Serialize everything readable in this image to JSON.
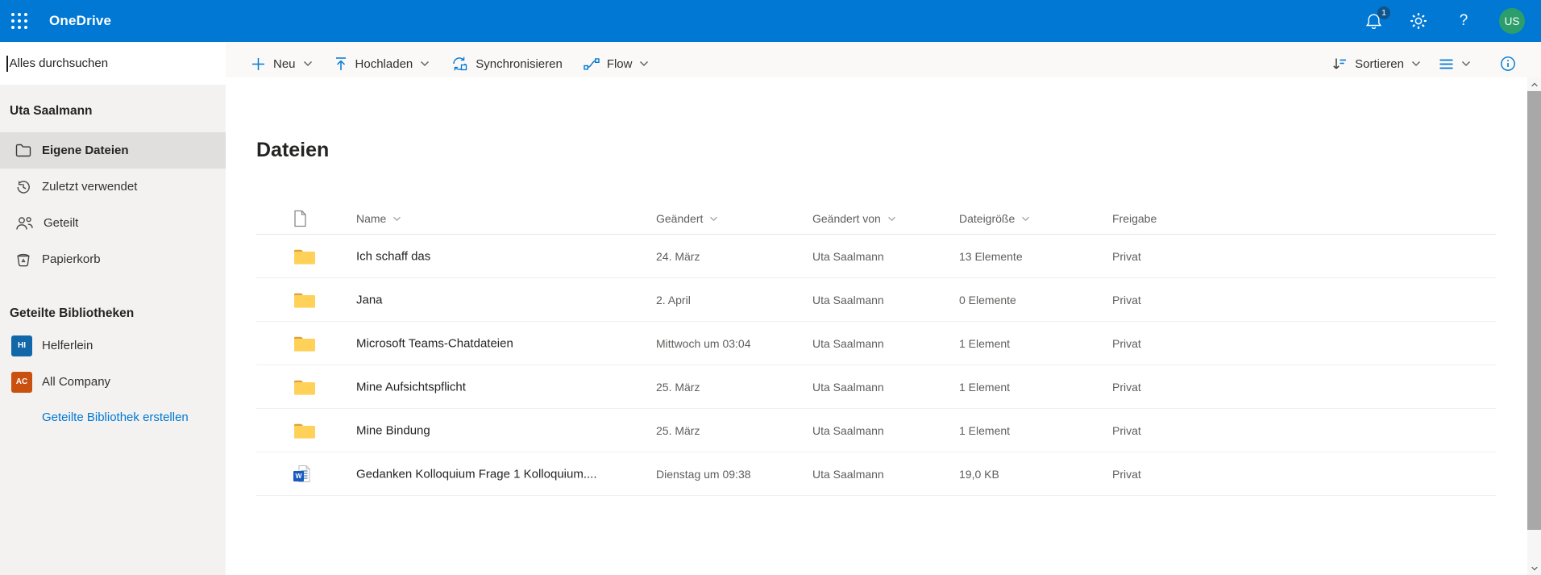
{
  "appbar": {
    "brand": "OneDrive",
    "notification_count": "1",
    "help_label": "?",
    "avatar_initials": "US",
    "colors": {
      "bar": "#0078D4",
      "badge": "#0F548C",
      "avatar": "#2B9E6B"
    }
  },
  "search": {
    "placeholder": "Alles durchsuchen"
  },
  "sidebar": {
    "owner": "Uta Saalmann",
    "items": [
      {
        "label": "Eigene Dateien",
        "icon": "folder-icon",
        "selected": true
      },
      {
        "label": "Zuletzt verwendet",
        "icon": "history-icon",
        "selected": false
      },
      {
        "label": "Geteilt",
        "icon": "people-icon",
        "selected": false
      },
      {
        "label": "Papierkorb",
        "icon": "recycle-bin-icon",
        "selected": false
      }
    ],
    "libraries_header": "Geteilte Bibliotheken",
    "libraries": [
      {
        "initials": "HI",
        "label": "Helferlein",
        "color": "#1267A9"
      },
      {
        "initials": "AC",
        "label": "All Company",
        "color": "#CA5010"
      }
    ],
    "create_library_link": "Geteilte Bibliothek erstellen"
  },
  "toolbar": {
    "new_label": "Neu",
    "upload_label": "Hochladen",
    "sync_label": "Synchronisieren",
    "flow_label": "Flow",
    "sort_label": "Sortieren"
  },
  "main": {
    "title": "Dateien",
    "table": {
      "columns": {
        "name": "Name",
        "modified": "Geändert",
        "modified_by": "Geändert von",
        "size": "Dateigröße",
        "sharing": "Freigabe"
      },
      "rows": [
        {
          "type": "folder",
          "name": "Ich schaff das",
          "modified": "24. März",
          "modified_by": "Uta Saalmann",
          "size": "13 Elemente",
          "sharing": "Privat"
        },
        {
          "type": "folder",
          "name": "Jana",
          "modified": "2. April",
          "modified_by": "Uta Saalmann",
          "size": "0 Elemente",
          "sharing": "Privat"
        },
        {
          "type": "folder",
          "name": "Microsoft Teams-Chatdateien",
          "modified": "Mittwoch um 03:04",
          "modified_by": "Uta Saalmann",
          "size": "1 Element",
          "sharing": "Privat"
        },
        {
          "type": "folder",
          "name": "Mine Aufsichtspflicht",
          "modified": "25. März",
          "modified_by": "Uta Saalmann",
          "size": "1 Element",
          "sharing": "Privat"
        },
        {
          "type": "folder",
          "name": "Mine Bindung",
          "modified": "25. März",
          "modified_by": "Uta Saalmann",
          "size": "1 Element",
          "sharing": "Privat"
        },
        {
          "type": "word",
          "name": "Gedanken Kolloquium Frage 1 Kolloquium....",
          "modified": "Dienstag um 09:38",
          "modified_by": "Uta Saalmann",
          "size": "19,0 KB",
          "sharing": "Privat"
        }
      ]
    }
  },
  "icons": {
    "word_letter": "W",
    "folder_body_color": "#FFD159",
    "folder_tab_color": "#DCA23A",
    "word_blue": "#185ABD",
    "accent_blue": "#0078D4"
  }
}
